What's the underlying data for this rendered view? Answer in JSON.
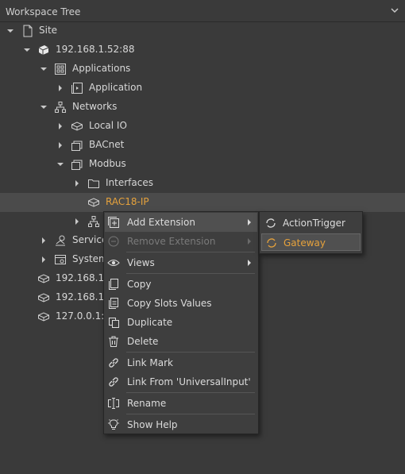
{
  "panel": {
    "title": "Workspace Tree"
  },
  "tree": {
    "site": "Site",
    "host1": "192.168.1.52:88",
    "applications": "Applications",
    "application": "Application",
    "networks": "Networks",
    "local_io": "Local IO",
    "bacnet": "BACnet",
    "modbus": "Modbus",
    "interfaces": "Interfaces",
    "rac18": "RAC18-IP",
    "services": "Service",
    "system": "System",
    "host2": "192.168.1.1",
    "host3": "192.168.1.1",
    "host4": "127.0.0.1:1"
  },
  "context_menu": {
    "add_extension": "Add Extension",
    "remove_extension": "Remove Extension",
    "views": "Views",
    "copy": "Copy",
    "copy_slots_values": "Copy Slots Values",
    "duplicate": "Duplicate",
    "delete": "Delete",
    "link_mark": "Link Mark",
    "link_from": "Link From 'UniversalInput'",
    "rename": "Rename",
    "show_help": "Show Help"
  },
  "submenu": {
    "action_trigger": "ActionTrigger",
    "gateway": "Gateway"
  },
  "colors": {
    "background": "#3a3a3a",
    "accent_orange": "#e6a23c",
    "text": "#d7d7d7",
    "disabled_text": "#7a7a7a"
  }
}
